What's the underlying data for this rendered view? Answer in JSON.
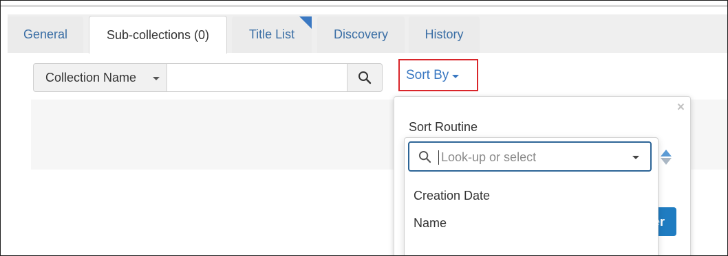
{
  "tabs": [
    {
      "label": "General"
    },
    {
      "label": "Sub-collections (0)"
    },
    {
      "label": "Title List"
    },
    {
      "label": "Discovery"
    },
    {
      "label": "History"
    }
  ],
  "filter": {
    "field_select": "Collection Name",
    "search_value": "",
    "search_icon": "search-icon"
  },
  "sort_by": {
    "label": "Sort By"
  },
  "popup": {
    "close_glyph": "×",
    "label": "Sort Routine",
    "lookup_placeholder": "Look-up or select",
    "options": [
      "Creation Date",
      "Name"
    ],
    "button_partial": "er"
  },
  "colors": {
    "accent": "#3a78c2",
    "highlight_border": "#d9252a",
    "primary_button": "#1f7cc1"
  }
}
